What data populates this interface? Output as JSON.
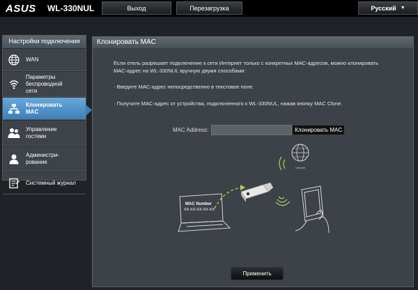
{
  "header": {
    "brand": "ASUS",
    "model": "WL-330NUL",
    "logout_label": "Выход",
    "reboot_label": "Перезагрузка",
    "language": "Русский"
  },
  "sidebar": {
    "title": "Настройки подключения",
    "items": [
      {
        "label": "WAN",
        "icon": "globe-icon"
      },
      {
        "label": "Параметры беспроводной сети",
        "icon": "wifi-icon"
      },
      {
        "label": "Клонировать MAC",
        "icon": "network-icon",
        "active": true
      },
      {
        "label": "Управление гостями",
        "icon": "users-icon"
      },
      {
        "label": "Администри- рование",
        "icon": "admin-icon"
      },
      {
        "label": "Системный журнал",
        "icon": "log-icon"
      }
    ]
  },
  "main": {
    "title": "Клонировать MAC",
    "intro_line1": "Если отель разрешает подключение к сети Интернет только с конкретных МАС-адресов, можно клонировать",
    "intro_line2": "МАС-адрес на WL-330NUL вручную двумя способами:",
    "option1": "· Введите МАС-адрес непосредственно в текстовое поле.",
    "option2": "· Получите МАС-адрес от устройства, подключенного к WL-330NUL, нажав кнопку MAC Clone.",
    "mac_label": "MAC Address:",
    "mac_value": "",
    "clone_button": "Клонировать MAC",
    "apply_button": "Применить",
    "illustration": {
      "internet_label": "Internet",
      "mac_number_label": "MAC Number",
      "mac_number_value": "XX-XX-XX-XX-XX"
    }
  }
}
